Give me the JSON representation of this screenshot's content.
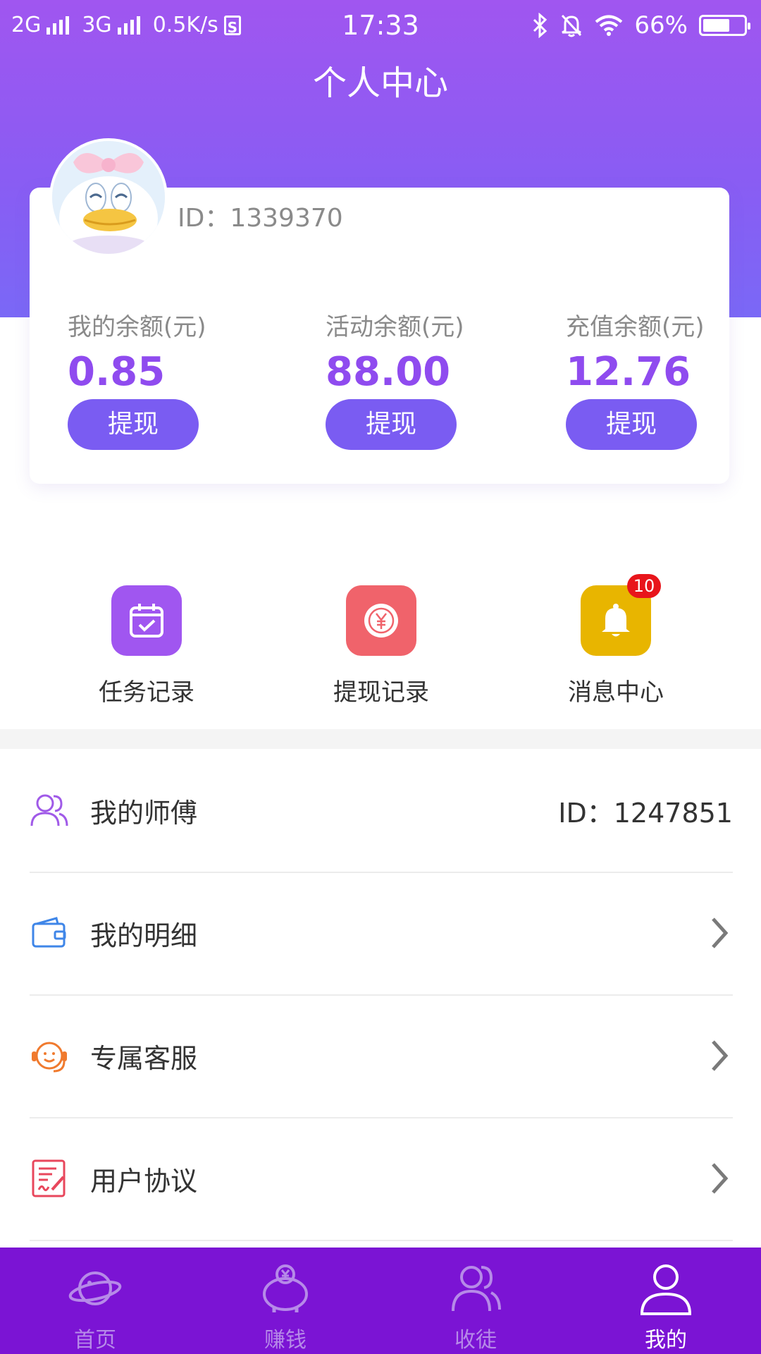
{
  "status_bar": {
    "network1": "2G",
    "network2": "3G",
    "speed": "0.5K/s",
    "sim": "S",
    "time": "17:33",
    "battery": "66%",
    "battery_level": 0.66
  },
  "header": {
    "title": "个人中心"
  },
  "profile": {
    "id_text": "ID：1339370"
  },
  "balances": [
    {
      "label": "我的余额(元)",
      "value": "0.85",
      "button": "提现"
    },
    {
      "label": "活动余额(元)",
      "value": "88.00",
      "button": "提现"
    },
    {
      "label": "充值余额(元)",
      "value": "12.76",
      "button": "提现"
    }
  ],
  "quick_actions": [
    {
      "label": "任务记录",
      "icon": "calendar-check-icon",
      "color": "#a056f0"
    },
    {
      "label": "提现记录",
      "icon": "yuan-coin-icon",
      "color": "#f0636b"
    },
    {
      "label": "消息中心",
      "icon": "bell-icon",
      "color": "#e8b500",
      "badge": "10"
    }
  ],
  "menu": [
    {
      "label": "我的师傅",
      "icon": "users-icon",
      "right_text": "ID：1247851"
    },
    {
      "label": "我的明细",
      "icon": "wallet-icon"
    },
    {
      "label": "专属客服",
      "icon": "headset-icon"
    },
    {
      "label": "用户协议",
      "icon": "document-sign-icon"
    }
  ],
  "tabbar": {
    "items": [
      {
        "label": "首页",
        "icon": "planet-icon"
      },
      {
        "label": "赚钱",
        "icon": "piggy-bank-icon"
      },
      {
        "label": "收徒",
        "icon": "users-icon"
      },
      {
        "label": "我的",
        "icon": "person-icon",
        "active": true
      }
    ]
  },
  "colors": {
    "header_top": "#a056f0",
    "header_bottom": "#7a68f6",
    "accent": "#8f4bef",
    "button": "#7a5cf2",
    "tabbar": "#7b14d4",
    "badge": "#e8151b"
  }
}
